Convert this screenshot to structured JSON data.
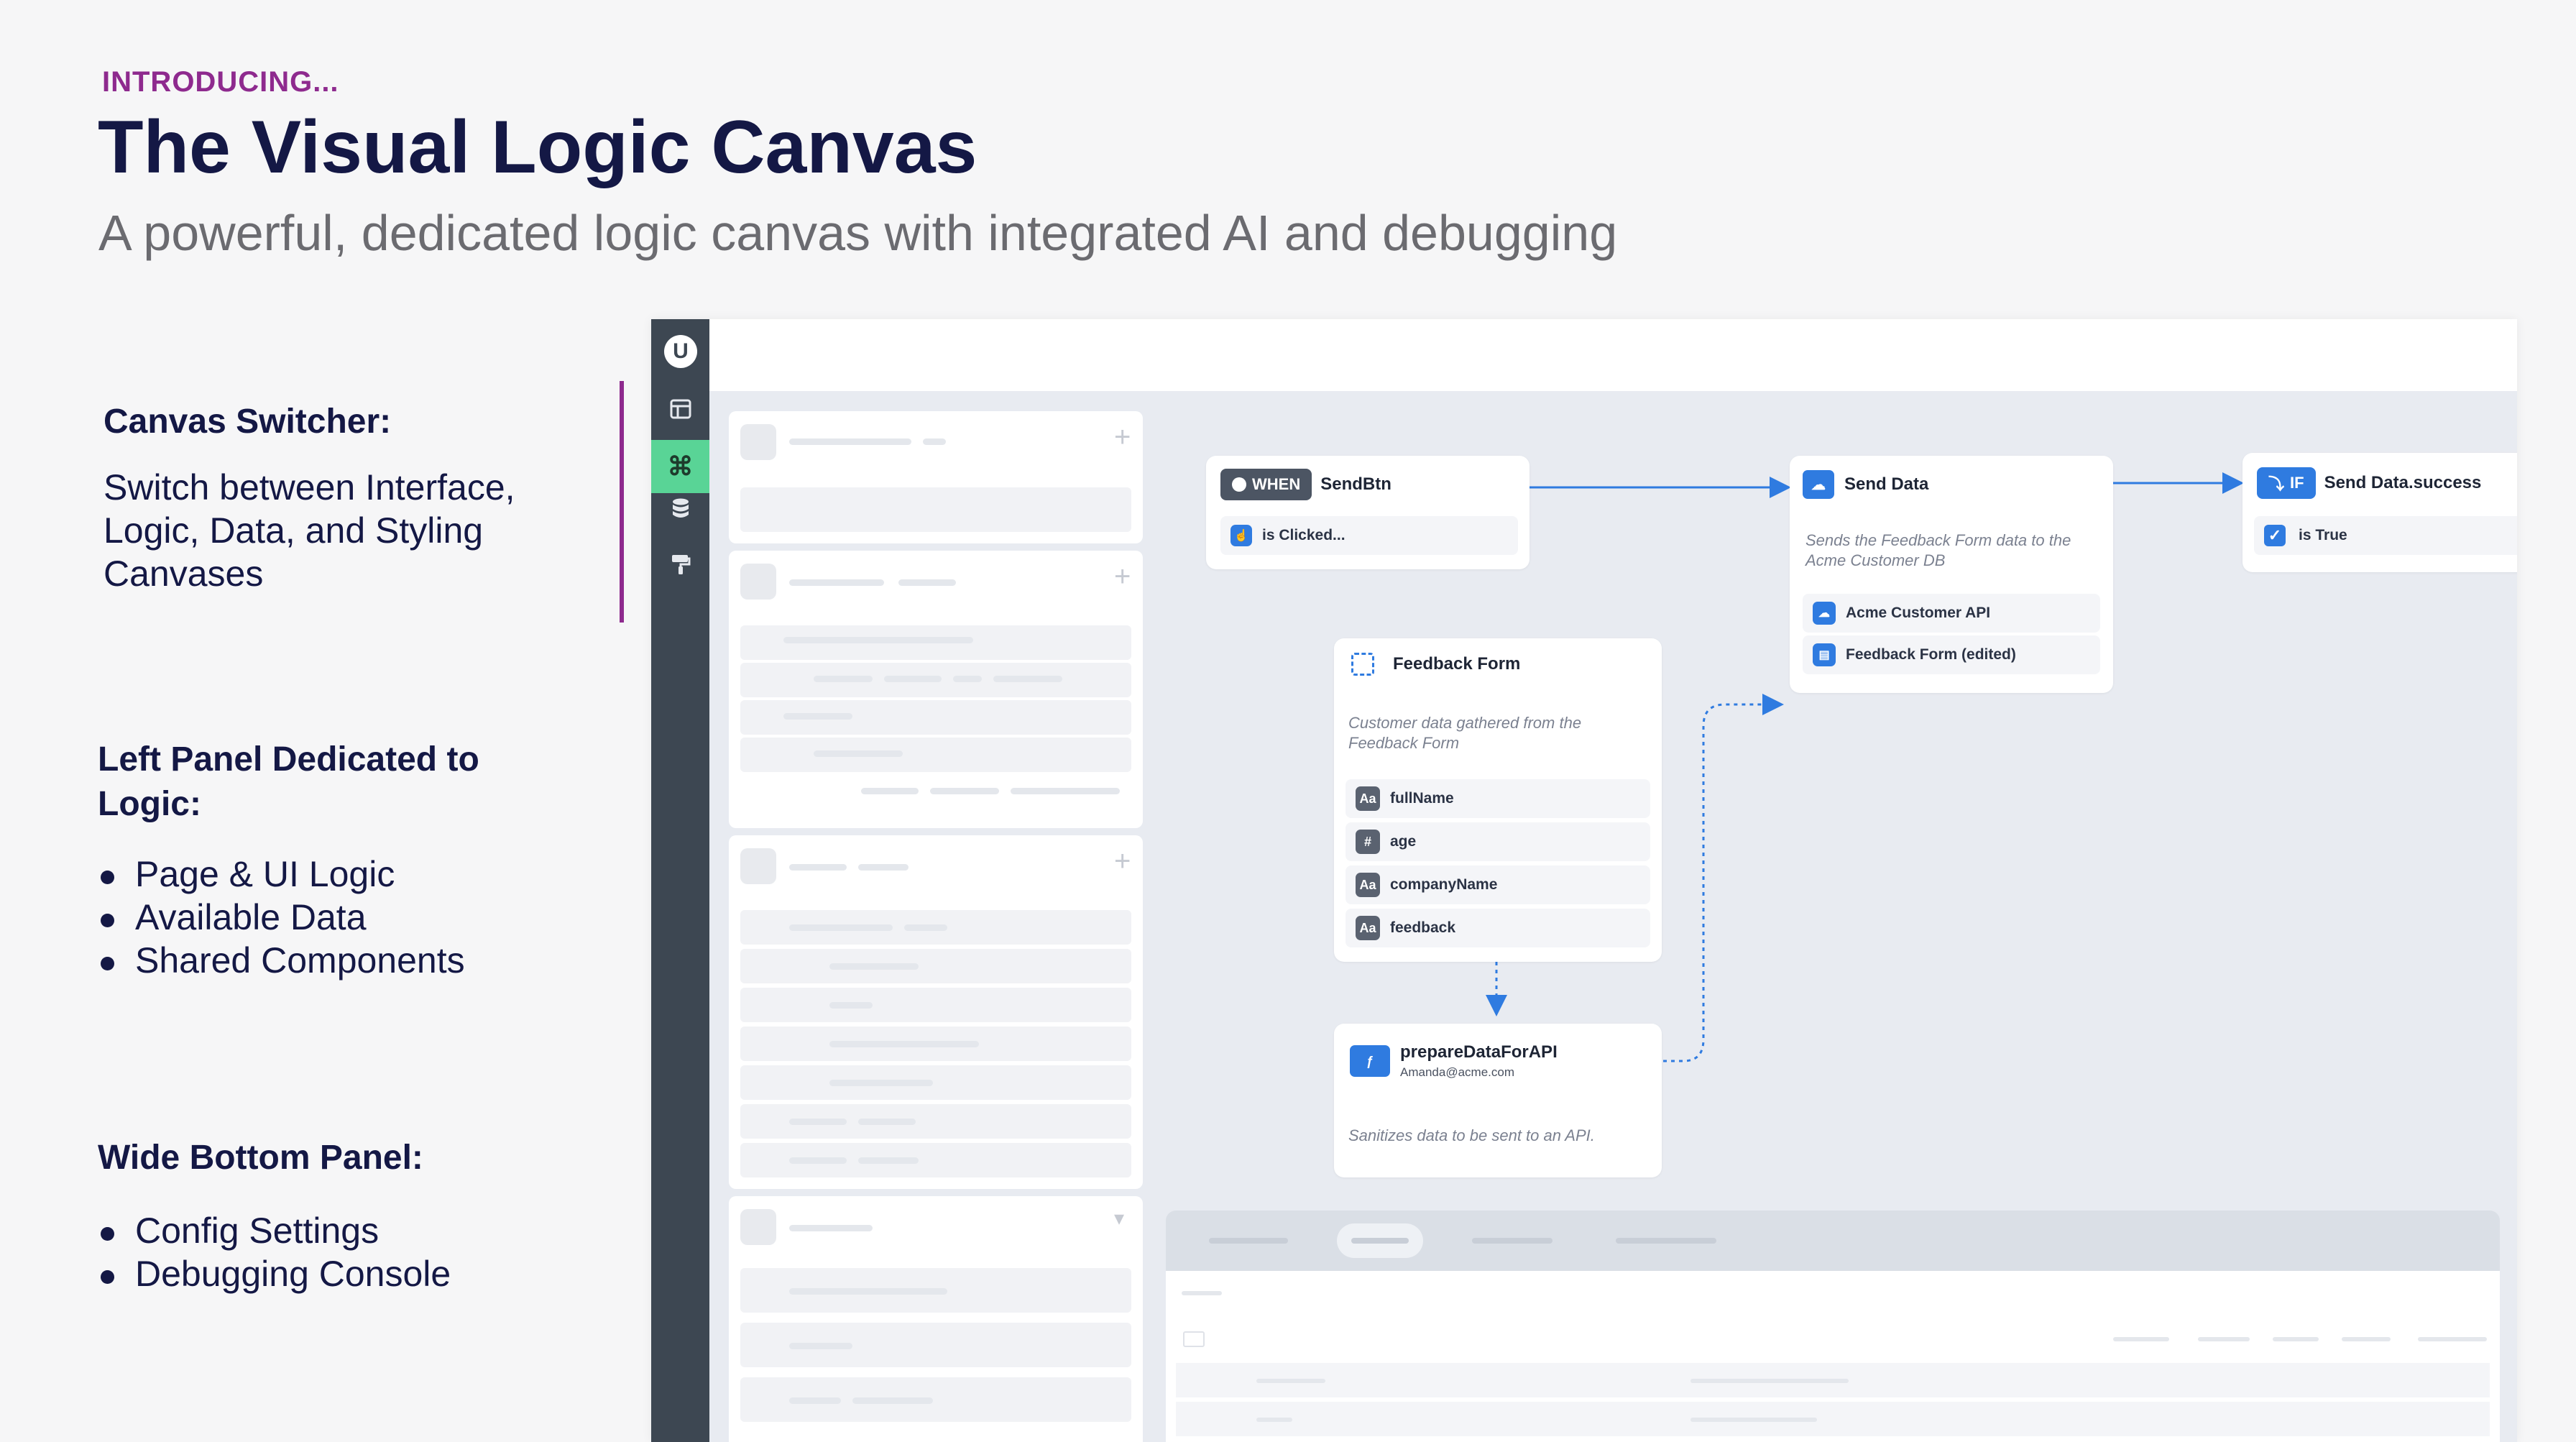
{
  "slide": {
    "eyebrow": "INTRODUCING...",
    "title": "The Visual Logic Canvas",
    "subtitle": "A powerful, dedicated logic canvas with integrated AI and debugging",
    "sections": [
      {
        "heading": "Canvas Switcher:",
        "text": [
          "Switch between Interface,",
          "Logic, Data, and Styling",
          "Canvases"
        ]
      },
      {
        "heading": [
          "Left Panel Dedicated to",
          "Logic:"
        ],
        "bullets": [
          "Page & UI Logic",
          "Available Data",
          "Shared Components"
        ]
      },
      {
        "heading": "Wide Bottom Panel:",
        "bullets": [
          "Config Settings",
          "Debugging Console"
        ]
      }
    ],
    "accent_color": "#8e2a8e"
  },
  "app": {
    "logo": "U",
    "rail_icons": [
      "interface-icon",
      "logic-icon",
      "data-icon",
      "styling-icon"
    ],
    "active_canvas": "logic",
    "accent_color": "#2f7be0",
    "nodes": {
      "when": {
        "chip": "WHEN",
        "target": "SendBtn",
        "event": "is Clicked..."
      },
      "send_data": {
        "title": "Send Data",
        "desc": "Sends the Feedback Form data to the Acme Customer DB",
        "rows": [
          "Acme Customer API",
          "Feedback Form (edited)"
        ]
      },
      "if": {
        "chip": "IF",
        "target": "Send Data.success",
        "condition": "is True"
      },
      "feedback_form": {
        "title": "Feedback Form",
        "desc": "Customer data gathered from the Feedback Form",
        "fields": [
          {
            "type": "Aa",
            "name": "fullName"
          },
          {
            "type": "#",
            "name": "age"
          },
          {
            "type": "Aa",
            "name": "companyName"
          },
          {
            "type": "Aa",
            "name": "feedback"
          }
        ]
      },
      "prepare": {
        "title": "prepareDataForAPI",
        "author": "Amanda@acme.com",
        "desc": "Sanitizes data to be sent to an API."
      }
    }
  }
}
